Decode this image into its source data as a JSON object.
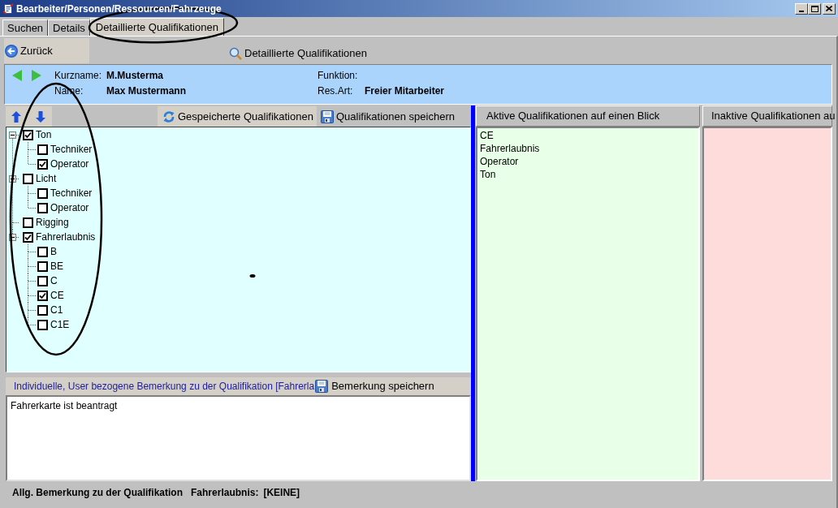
{
  "window": {
    "title": "Bearbeiter/Personen/Ressourcen/Fahrzeuge"
  },
  "tabs": [
    {
      "label": "Suchen",
      "selected": false
    },
    {
      "label": "Details",
      "selected": false
    },
    {
      "label": "Detaillierte Qualifikationen",
      "selected": true
    }
  ],
  "toolbar": {
    "back_button": "Zurück",
    "title": "Detaillierte Qualifikationen"
  },
  "person": {
    "fields": [
      {
        "label": "Kurzname:",
        "value": "M.Musterma"
      },
      {
        "label": "Name:",
        "value": "Max Mustermann"
      },
      {
        "label": "Funktion:"
      },
      {
        "label": "Res.Art:",
        "value": "Freier Mitarbeiter"
      }
    ]
  },
  "qualifications": {
    "load_button": "Gespeicherte Qualifikationen",
    "save_button": "Qualifikationen speichern",
    "tree": [
      {
        "label": "Ton",
        "checked": true,
        "expanded": true,
        "children": [
          {
            "label": "Techniker",
            "checked": false
          },
          {
            "label": "Operator",
            "checked": true
          }
        ]
      },
      {
        "label": "Licht",
        "checked": false,
        "expanded": true,
        "children": [
          {
            "label": "Techniker",
            "checked": false
          },
          {
            "label": "Operator",
            "checked": false
          }
        ]
      },
      {
        "label": "Rigging",
        "checked": false
      },
      {
        "label": "Fahrerlaubnis",
        "checked": true,
        "expanded": true,
        "children": [
          {
            "label": "B",
            "checked": false
          },
          {
            "label": "BE",
            "checked": false
          },
          {
            "label": "C",
            "checked": false
          },
          {
            "label": "CE",
            "checked": true
          },
          {
            "label": "C1",
            "checked": false
          },
          {
            "label": "C1E",
            "checked": false
          }
        ]
      }
    ]
  },
  "remark": {
    "label": "Individuelle, User bezogene Bemerkung zu der Qualifikation [Fahrerla",
    "save_button": "Bemerkung speichern",
    "value": "Fahrerkarte ist beantragt"
  },
  "active_panel": {
    "title": "Aktive Qualifikationen auf einen Blick",
    "items": [
      "CE",
      "Fahrerlaubnis",
      "Operator",
      "Ton"
    ]
  },
  "inactive_panel": {
    "title": "Inaktive Qualifikationen au"
  },
  "status_bar": {
    "label": "Allg. Bemerkung zu der Qualifikation",
    "field": "Fahrerlaubnis:",
    "value": "[KEINE]"
  }
}
